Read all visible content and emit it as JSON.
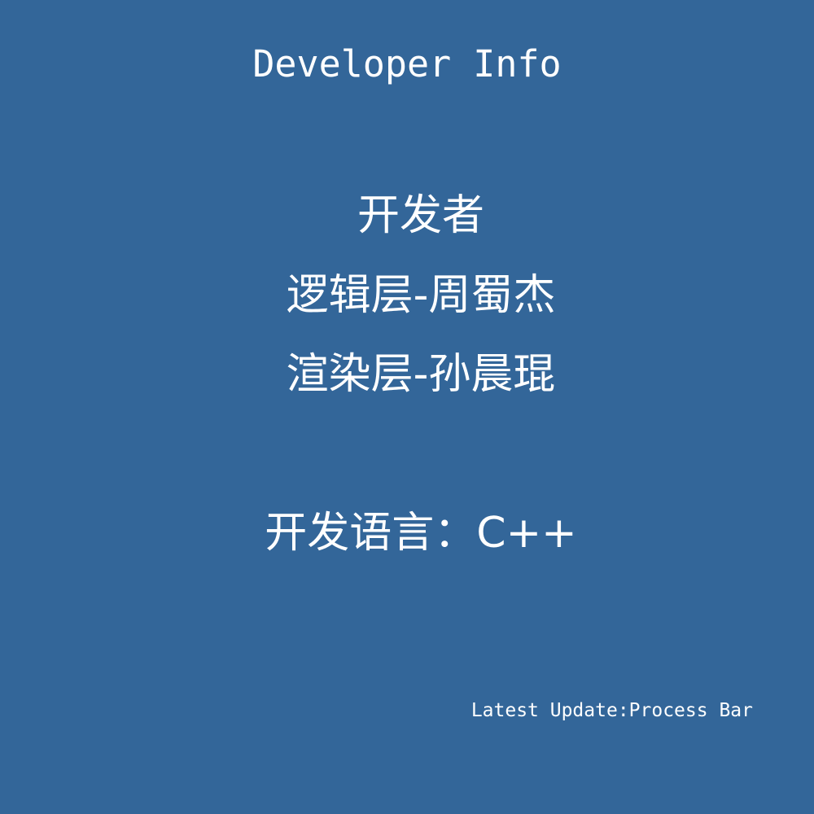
{
  "background_color": "#336699",
  "title": "Developer Info",
  "developers_heading": "开发者",
  "logic_layer": "逻辑层-周蜀杰",
  "render_layer": "渲染层-孙晨琨",
  "language": "开发语言：C++",
  "latest_update": "Latest Update:Process Bar"
}
